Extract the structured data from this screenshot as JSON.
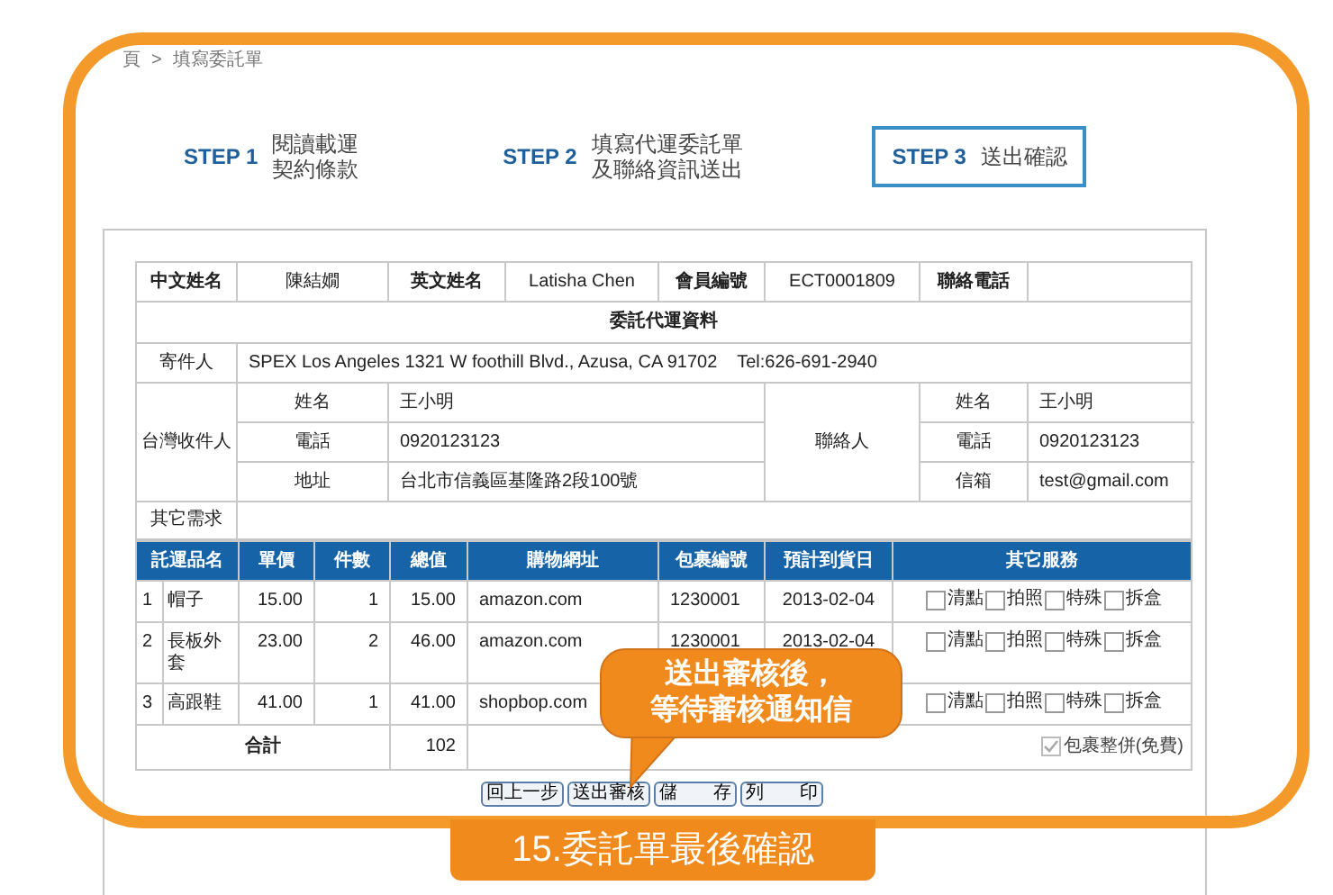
{
  "breadcrumb": {
    "items": [
      "頁",
      "填寫委託單"
    ],
    "separator": ">"
  },
  "steps": [
    {
      "label": "STEP 1",
      "title_lines": [
        "閱讀載運",
        "契約條款"
      ],
      "selected": false
    },
    {
      "label": "STEP 2",
      "title_lines": [
        "填寫代運委託單",
        "及聯絡資訊送出"
      ],
      "selected": false
    },
    {
      "label": "STEP 3",
      "title_lines": [
        "送出確認"
      ],
      "selected": true
    }
  ],
  "member": [
    {
      "label": "中文姓名",
      "value": "陳結嫺"
    },
    {
      "label": "英文姓名",
      "value": "Latisha Chen"
    },
    {
      "label": "會員編號",
      "value": "ECT0001809"
    },
    {
      "label": "聯絡電話"
    }
  ],
  "section_title": "委託代運資料",
  "sender": {
    "label": "寄件人",
    "value": "SPEX Los Angeles 1321 W foothill Blvd., Azusa, CA 91702    Tel:626-691-2940"
  },
  "recipient": {
    "label": "台灣收件人",
    "fields": [
      {
        "label": "姓名",
        "value": "王小明"
      },
      {
        "label": "電話",
        "value": "0920123123"
      },
      {
        "label": "地址",
        "value": "台北市信義區基隆路2段100號"
      }
    ]
  },
  "contact": {
    "label": "聯絡人",
    "fields": [
      {
        "label": "姓名",
        "value": "王小明"
      },
      {
        "label": "電話",
        "value": "0920123123"
      },
      {
        "label": "信箱",
        "value": "test@gmail.com"
      }
    ]
  },
  "other_needs": {
    "label": "其它需求"
  },
  "items_table": {
    "columns": [
      "託運品名",
      "單價",
      "件數",
      "總值",
      "購物網址",
      "包裹編號",
      "預計到貨日",
      "其它服務"
    ],
    "rows": [
      {
        "index": "1",
        "name": "帽子",
        "price": "15.00",
        "qty": "1",
        "total": "15.00",
        "url": "amazon.com",
        "package_no": "1230001",
        "arrival": "2013-02-04",
        "services": [
          {
            "label": "清點",
            "checked": false
          },
          {
            "label": "拍照",
            "checked": false
          },
          {
            "label": "特殊",
            "checked": false
          },
          {
            "label": "拆盒",
            "checked": false
          }
        ]
      },
      {
        "index": "2",
        "name": "長板外套",
        "price": "23.00",
        "qty": "2",
        "total": "46.00",
        "url": "amazon.com",
        "package_no": "1230001",
        "arrival": "2013-02-04",
        "services": [
          {
            "label": "清點",
            "checked": false
          },
          {
            "label": "拍照",
            "checked": false
          },
          {
            "label": "特殊",
            "checked": false
          },
          {
            "label": "拆盒",
            "checked": false
          }
        ]
      },
      {
        "index": "3",
        "name": "高跟鞋",
        "price": "41.00",
        "qty": "1",
        "total": "41.00",
        "url": "shopbop.com",
        "services": [
          {
            "label": "清點",
            "checked": false
          },
          {
            "label": "拍照",
            "checked": false
          },
          {
            "label": "特殊",
            "checked": false
          },
          {
            "label": "拆盒",
            "checked": false
          }
        ]
      }
    ],
    "total_label": "合計",
    "total_value": "102",
    "consolidate": {
      "label": "包裹整併(免費)",
      "checked": true,
      "disabled": true
    }
  },
  "buttons": [
    "回上一步",
    "送出審核",
    "儲　　存",
    "列　　印"
  ],
  "callout": {
    "lines": [
      "送出審核後，",
      "等待審核通知信"
    ]
  },
  "caption": "15.委託單最後確認"
}
